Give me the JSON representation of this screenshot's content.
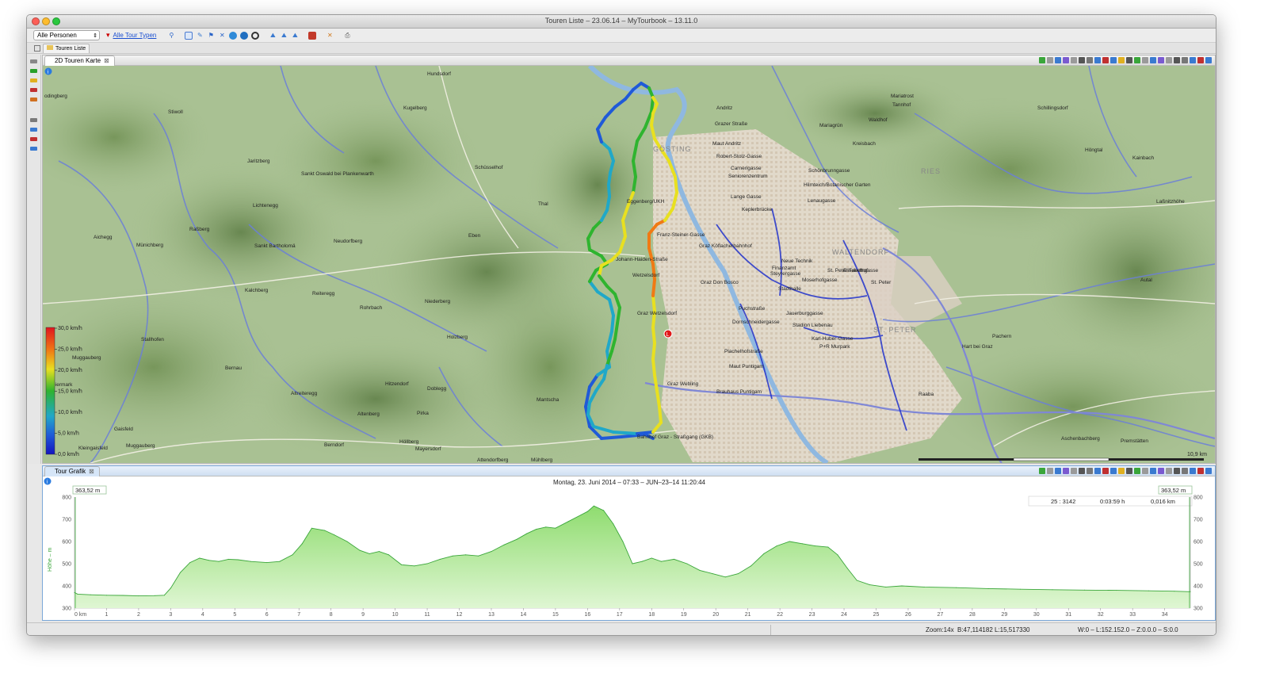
{
  "window": {
    "title": "Touren Liste – 23.06.14 – MyTourbook – 13.11.0"
  },
  "toolbar": {
    "person_select": "Alle Personen",
    "tour_types_link": "Alle Tour Typen"
  },
  "top_tab": {
    "label": "Touren Liste"
  },
  "map_view": {
    "tab_label": "2D Touren Karte",
    "scale_label": "10,9 km"
  },
  "legend": {
    "labels": [
      "30,0 km/h",
      "25,0 km/h",
      "20,0 km/h",
      "15,0 km/h",
      "10,0 km/h",
      "5,0 km/h",
      "0,0 km/h"
    ]
  },
  "map_labels": {
    "places": [
      "Hundsdorf",
      "odingberg",
      "Stiwoll",
      "Kugelberg",
      "Andritz",
      "Grazer Straße",
      "Maut Andritz",
      "Robert-Stolz-Gasse",
      "Carnerigasse",
      "Seniorenzentrum",
      "Lange Gasse",
      "Kepler­brücke",
      "Mariatrost",
      "Tannhof",
      "Waldhof",
      "Kreisbach",
      "Mariagrün",
      "Schönbrunngasse",
      "Hilmteich/Botanischer Garten",
      "Lenaugasse",
      "Schillingsdorf",
      "Höngtal",
      "Kainbach",
      "Laßnitzhöhe",
      "Jaritzberg",
      "Sankt Oswald bei Plankenwarth",
      "Schüsselhof",
      "Lichtenegg",
      "Thal",
      "Eggenberg/UKH",
      "Raßberg",
      "Aichegg",
      "Münichberg",
      "Sankt Bartholomä",
      "Neudorfberg",
      "Eben",
      "Johann-Haiden-Straße",
      "Graz Köflacherbahnhof",
      "Franz-Steiner-Gasse",
      "Neue Technik",
      "Finanzamt",
      "St. Peter Friedhof",
      "Steyrergasse",
      "Elisabethgasse",
      "Moserhofgasse",
      "St. Peter",
      "Stadthalle",
      "Wetzelsdorf",
      "Graz Don Bosco",
      "Autal",
      "Kalchberg",
      "Reiteregg",
      "Rohrbach",
      "Niederberg",
      "Graz Wetzelsdorf",
      "Puchstraße",
      "Jauerburggasse",
      "Dornschneidergasse",
      "Stadion Liebenau",
      "Karl-Huber-Gasse",
      "P+R Murpark",
      "Hart bei Graz",
      "Pachern",
      "Stallhofen",
      "Holzberg",
      "Plachelhofstraße",
      "Muggauberg",
      "Bernau",
      "Maut Puntigam",
      "Hitzendorf",
      "Graz Webling",
      "Brauhaus Puntigam",
      "Raaba",
      "Altreiteregg",
      "Doblegg",
      "Mantscha",
      "Gaisfeld",
      "Altenberg",
      "Pirka",
      "Kleingaisfeld",
      "Höllberg",
      "Mayersdorf",
      "Bahnhof Graz - Straßgang (GKB)",
      "Muggauberg",
      "Berndorf",
      "Attendorfberg",
      "Mühlberg",
      "Aschenbachberg",
      "Premstätten",
      "Steiermark"
    ],
    "districts": [
      "GÖSTING",
      "RIES",
      "WALTENDORF",
      "ST. PETER"
    ]
  },
  "graph_view": {
    "tab_label": "Tour Grafik",
    "header": "Montag, 23. Juni 2014 – 07:33 – JUN–23–14 11:20:44",
    "left_value": "363,52 m",
    "right_value": "363,52 m",
    "info": [
      "25 : 3142",
      "0:03:59 h",
      "0,016 km"
    ],
    "y_axis_title": "Höhe – m"
  },
  "chart_data": {
    "type": "area",
    "title": "Montag, 23. Juni 2014 – 07:33 – JUN–23–14 11:20:44",
    "xlabel": "km",
    "ylabel": "Höhe – m",
    "xlim": [
      0,
      34.8
    ],
    "ylim": [
      300,
      800
    ],
    "x_ticks": [
      "0 km",
      "1",
      "2",
      "3",
      "4",
      "5",
      "6",
      "7",
      "8",
      "9",
      "10",
      "11",
      "12",
      "13",
      "14",
      "15",
      "16",
      "17",
      "18",
      "19",
      "20",
      "21",
      "22",
      "23",
      "24",
      "25",
      "26",
      "27",
      "28",
      "29",
      "30",
      "31",
      "32",
      "33",
      "34"
    ],
    "y_ticks": [
      300,
      400,
      500,
      600,
      700,
      800
    ],
    "series": [
      {
        "color": "#3aa63a",
        "x": [
          0,
          0.1,
          0.5,
          1,
          1.5,
          2,
          2.5,
          2.8,
          3,
          3.3,
          3.6,
          3.9,
          4.2,
          4.5,
          4.8,
          5.1,
          5.5,
          6,
          6.4,
          6.8,
          7.1,
          7.4,
          7.8,
          8.1,
          8.5,
          8.9,
          9.2,
          9.5,
          9.8,
          10.2,
          10.6,
          11,
          11.4,
          11.8,
          12.2,
          12.6,
          13,
          13.4,
          13.8,
          14.1,
          14.4,
          14.7,
          15,
          15.4,
          15.8,
          16,
          16.2,
          16.5,
          16.8,
          17.1,
          17.4,
          17.7,
          18,
          18.3,
          18.7,
          19.1,
          19.5,
          19.9,
          20.3,
          20.7,
          21.1,
          21.5,
          21.9,
          22.3,
          22.7,
          23.1,
          23.5,
          23.8,
          24.1,
          24.4,
          24.8,
          25.3,
          25.8,
          26.5,
          27.5,
          28.5,
          29.5,
          30.5,
          31.5,
          32.5,
          33.5,
          34.3,
          34.8
        ],
        "y": [
          370,
          363,
          360,
          358,
          357,
          355,
          356,
          358,
          390,
          460,
          505,
          525,
          515,
          510,
          520,
          518,
          510,
          505,
          510,
          540,
          590,
          660,
          650,
          630,
          600,
          560,
          545,
          555,
          540,
          495,
          490,
          500,
          520,
          535,
          540,
          535,
          555,
          585,
          610,
          635,
          655,
          665,
          660,
          690,
          720,
          735,
          760,
          740,
          680,
          600,
          500,
          510,
          525,
          510,
          520,
          500,
          470,
          455,
          440,
          455,
          490,
          545,
          580,
          600,
          590,
          580,
          575,
          540,
          480,
          425,
          405,
          395,
          400,
          395,
          392,
          388,
          385,
          383,
          381,
          380,
          378,
          376,
          374
        ]
      }
    ],
    "grid": false,
    "legend": "none"
  },
  "statusbar": {
    "zoom": "Zoom:14x",
    "coords": "B:47,114182  L:15,517330",
    "info": "W:0 – L:152.152.0 – Z:0.0.0 – S:0.0"
  }
}
